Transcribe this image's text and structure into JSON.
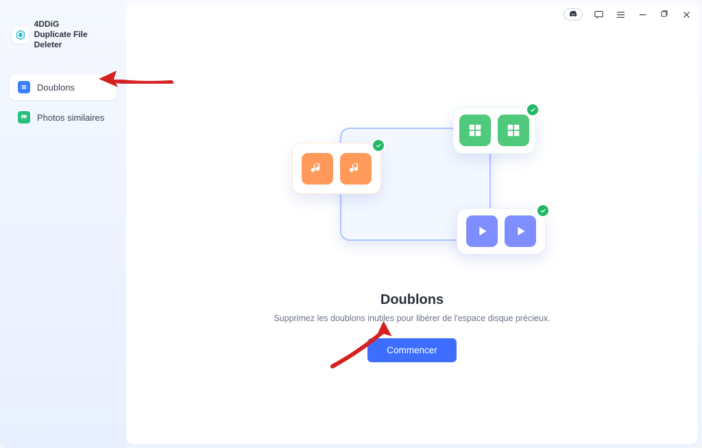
{
  "app": {
    "name": "4DDiG\nDuplicate File Deleter"
  },
  "sidebar": {
    "items": [
      {
        "label": "Doublons"
      },
      {
        "label": "Photos similaires"
      }
    ]
  },
  "main": {
    "heading": "Doublons",
    "subheading": "Supprimez les doublons inutiles pour libérer de l'espace disque précieux.",
    "cta": "Commencer"
  }
}
